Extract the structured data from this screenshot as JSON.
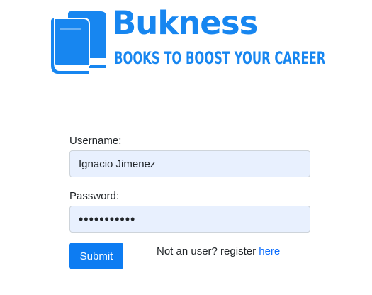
{
  "logo": {
    "icon": "books-icon",
    "brand_name": "Bukness",
    "tagline": "BOOKS TO BOOST YOUR CAREER"
  },
  "form": {
    "username_label": "Username:",
    "username_value": "Ignacio Jimenez",
    "password_label": "Password:",
    "password_value": "•••••••••••",
    "submit_label": "Submit",
    "register_prefix": "Not an user? register ",
    "register_link": "here"
  },
  "colors": {
    "brand": "#1786f0",
    "primary_button": "#0d7cf2",
    "link": "#0d6efd",
    "autofill_bg": "#e8f0fe"
  }
}
